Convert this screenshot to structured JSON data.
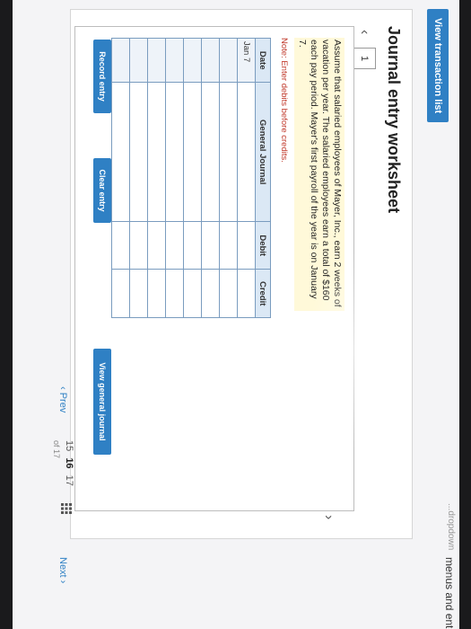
{
  "banner": {
    "text": "menus and enter",
    "fade_text": "...dropdown"
  },
  "toolbar": {
    "view_transaction_list": "View transaction list"
  },
  "worksheet": {
    "title": "Journal entry worksheet",
    "entry_tab": "1",
    "prev_arrow": "‹",
    "next_arrow": "›",
    "instruction": "Assume that salaried employees of Mayer, Inc., earn 2 weeks of vacation per year. The salaried employees earn a total of $160 each pay period. Mayer's first payroll of the year is on January 7.",
    "note": "Note: Enter debits before credits.",
    "table": {
      "headers": {
        "date": "Date",
        "general_journal": "General Journal",
        "debit": "Debit",
        "credit": "Credit"
      },
      "rows": [
        {
          "date": "Jan 7",
          "account": "",
          "debit": "",
          "credit": ""
        },
        {
          "date": "",
          "account": "",
          "debit": "",
          "credit": ""
        },
        {
          "date": "",
          "account": "",
          "debit": "",
          "credit": ""
        },
        {
          "date": "",
          "account": "",
          "debit": "",
          "credit": ""
        },
        {
          "date": "",
          "account": "",
          "debit": "",
          "credit": ""
        },
        {
          "date": "",
          "account": "",
          "debit": "",
          "credit": ""
        },
        {
          "date": "",
          "account": "",
          "debit": "",
          "credit": ""
        },
        {
          "date": "",
          "account": "",
          "debit": "",
          "credit": ""
        }
      ]
    },
    "buttons": {
      "record_entry": "Record entry",
      "clear_entry": "Clear entry",
      "view_general_journal": "View general journal"
    }
  },
  "pager": {
    "prev": "‹ Prev",
    "pages": [
      "15",
      "16",
      "17"
    ],
    "current_page": "16",
    "of_text": "of 17",
    "next": "Next ›"
  },
  "colors": {
    "accent": "#2f80c4",
    "header_bg": "#dbe8f5",
    "note": "#c0392b"
  }
}
